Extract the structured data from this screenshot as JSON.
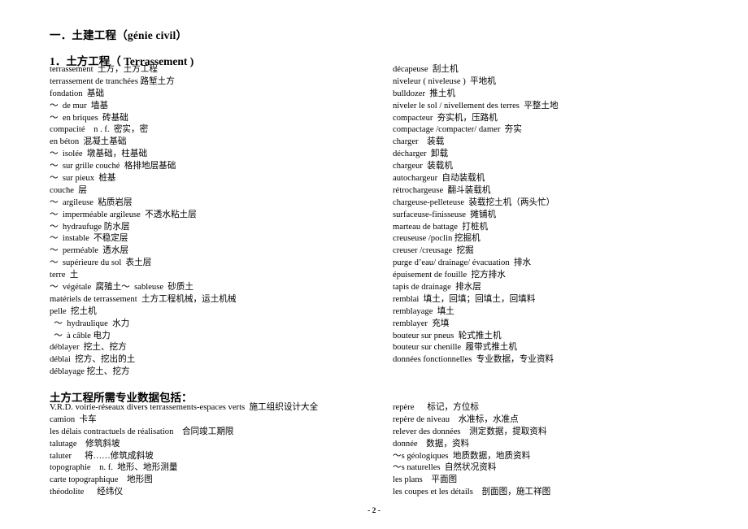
{
  "document": {
    "section_title": "一．土建工程（génie civil）",
    "subsection_title": "1．土方工程（ Terrassement )",
    "terrassement_left": [
      "terrassement  土方，土方工程",
      "terrassement de tranchées 路堑土方",
      "fondation  基础",
      "～  de mur  墙基",
      "～  en briques  砖基础",
      "compacité    n . f.  密实，密",
      "en béton  混凝土基础",
      "～  isolée  墩基础，柱基础",
      "～  sur grille couché  格排地层基础",
      "～  sur pieux  桩基",
      "couche  层",
      "～  argileuse  粘质岩层",
      "～  imperméable argileuse  不透水粘土层",
      "～  hydraufuge 防水层",
      "～  instable  不稳定层",
      "～  perméable  透水层",
      "～  supérieure du sol  表土层",
      "terre  土",
      "～  végétale  腐殖土～  sableuse  砂质土",
      "matériels de terrassement  土方工程机械，运土机械",
      "pelle  挖土机",
      "  ～  hydraulique  水力",
      "  ～  à câble 电力",
      "déblayer  挖土、挖方",
      "déblai  挖方、挖出的土",
      "déblayage 挖土、挖方"
    ],
    "terrassement_right": [
      "décapeuse  刮土机",
      "niveleur ( niveleuse )  平地机",
      "bulldozer  推土机",
      "niveler le sol / nivellement des terres  平整土地",
      "compacteur  夯实机，压路机",
      "compactage /compacter/ damer  夯实",
      "charger    装载",
      "décharger  卸载",
      "chargeur  装载机",
      "autochargeur  自动装载机",
      "rétrochargeuse  翻斗装载机",
      "chargeuse-pelleteuse  装载挖土机（两头忙）",
      "surfaceuse-finisseuse  摊铺机",
      "marteau de battage  打桩机",
      "creuseuse /poclin 挖掘机",
      "creuser /creusage  挖掘",
      "purge d’eau/ drainage/ évacuation  排水",
      "épuisement de fouille  挖方排水",
      "tapis de drainage  排水层",
      "remblai  填土，回填；回填土，回填料",
      "remblayage  填土",
      "remblayer  充填",
      "bouteur sur pneus  轮式推土机",
      "bouteur sur chenille  履带式推土机",
      "données fonctionnelles  专业数据，专业资料"
    ],
    "data_section_title": "土方工程所需专业数据包括：",
    "data_left": [
      "V.R.D. voirie-réseaux divers terrassements-espaces verts  施工组织设计大全",
      "camion  卡车",
      "les délais contractuels de réalisation    合同竣工期限",
      "talutage    修筑斜坡",
      "taluter      将……修筑成斜坡",
      "topographie    n. f.  地形、地形测量",
      "carte topographique    地形图",
      "théodolite      经纬仪"
    ],
    "data_right": [
      "repère      标记，方位标",
      "repère de niveau    水准标，水准点",
      "relever des données    测定数据，提取资料",
      "donnée    数据，资料",
      "～s géologiques  地质数据，地质资料",
      "～s naturelles  自然状况资料",
      "les plans    平面图",
      "les coupes et les détails    剖面图，施工祥图"
    ],
    "page_number": "- 2 -"
  }
}
